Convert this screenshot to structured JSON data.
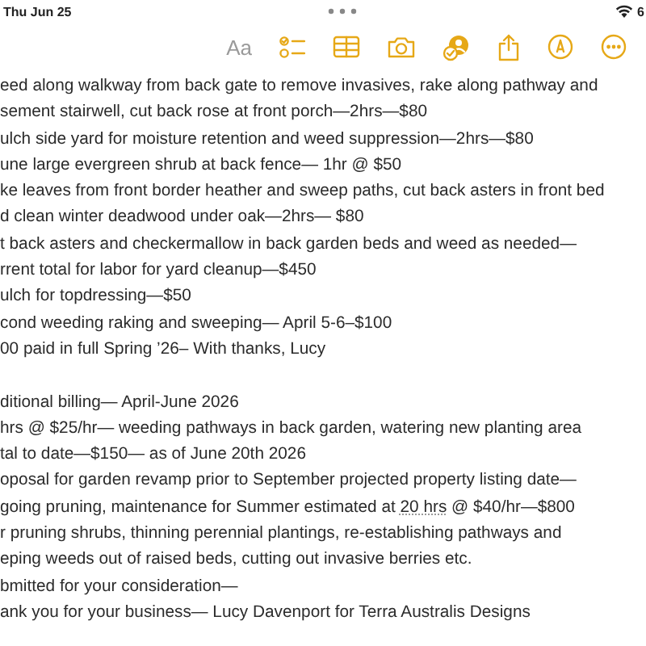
{
  "status_bar": {
    "time": "Thu Jun 25",
    "battery": "6"
  },
  "toolbar": [
    {
      "kind": "format",
      "label": "Aa",
      "disabled": true
    },
    {
      "kind": "checklist",
      "disabled": false
    },
    {
      "kind": "table",
      "disabled": false
    },
    {
      "kind": "camera",
      "disabled": false
    },
    {
      "kind": "assistant",
      "disabled": false
    },
    {
      "kind": "share",
      "disabled": false
    },
    {
      "kind": "markup",
      "disabled": false
    },
    {
      "kind": "more",
      "disabled": false
    }
  ],
  "note": {
    "sections": [
      [
        {
          "text": "eed along walkway from back gate to remove invasives, rake along pathway and"
        },
        {
          "text": "sement stairwell, cut back rose at front porch—2hrs—$80"
        },
        {
          "text": "ulch side yard for moisture retention and weed suppression—2hrs—$80"
        },
        {
          "text": "une large evergreen shrub at back fence— 1hr @ $50"
        },
        {
          "text": "ke leaves from front border heather and sweep paths, cut back asters in front bed"
        },
        {
          "text": "d clean winter deadwood under oak—2hrs— $80"
        },
        {
          "text": "t back asters and checkermallow in back garden beds and weed as needed—"
        },
        {
          "text": "rrent total for labor for yard cleanup—$450"
        },
        {
          "text": "ulch for topdressing—$50"
        },
        {
          "text": "cond weeding raking and sweeping— April 5-6–$100"
        },
        {
          "text": "00 paid in full Spring ’26– With thanks, Lucy"
        }
      ],
      [
        {
          "text": "ditional billing— April-June 2026"
        },
        {
          "text": "hrs @ $25/hr— weeding pathways in back garden, watering new planting area"
        },
        {
          "text": "tal to date—$150— as of June 20th 2026"
        },
        {
          "text": "oposal for garden revamp prior to September projected property listing date—"
        },
        {
          "segments": [
            {
              "text": "going pruning, maintenance for Summer estimated at ",
              "detected": false
            },
            {
              "text": "20 hrs",
              "detected": true
            },
            {
              "text": " @ $40/hr—$800",
              "detected": false
            }
          ]
        },
        {
          "text": "r pruning shrubs, thinning perennial plantings, re-establishing pathways and"
        },
        {
          "text": "eping weeds out of raised beds, cutting out invasive berries etc."
        },
        {
          "text": "bmitted for your consideration—"
        },
        {
          "text": "ank you for your business— Lucy Davenport for Terra Australis Designs"
        }
      ]
    ]
  }
}
